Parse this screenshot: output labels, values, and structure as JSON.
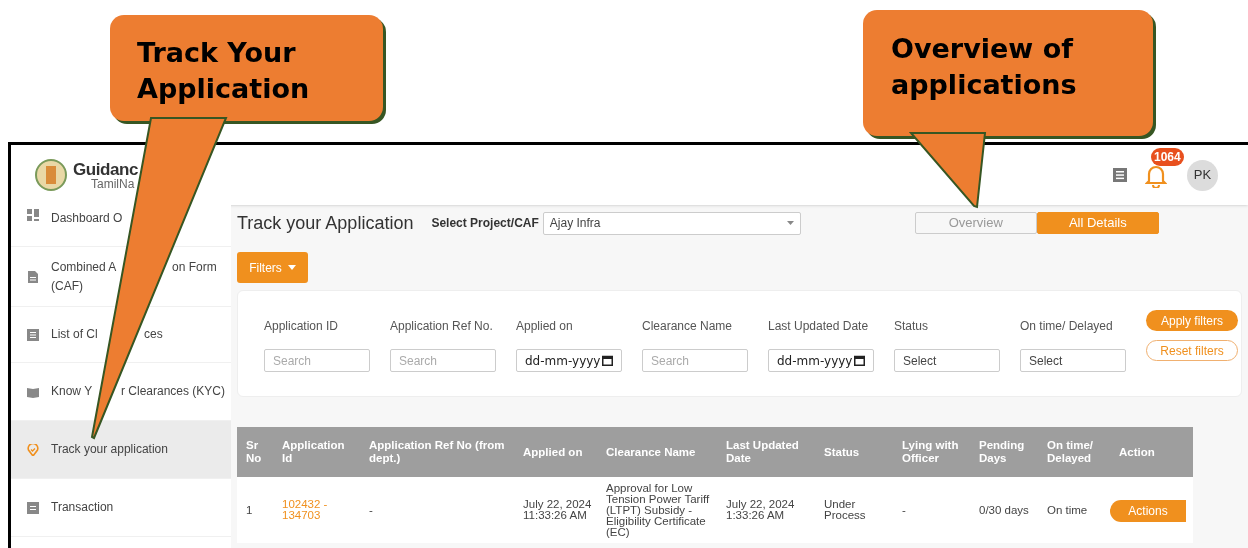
{
  "callouts": [
    {
      "text": "Track Your Application"
    },
    {
      "text": "Overview of applications"
    }
  ],
  "header": {
    "logo_title": "Guidanc",
    "logo_subtitle": "TamilNa",
    "notification_count": "1064",
    "avatar": "PK"
  },
  "sidebar": {
    "items": [
      {
        "label_parts": [
          "Dashboard O"
        ],
        "selected": false
      },
      {
        "label_parts": [
          "Combined A",
          "on Form",
          "(CAF)"
        ],
        "selected": false
      },
      {
        "label_parts": [
          "List of Cl",
          "ces"
        ],
        "selected": false
      },
      {
        "label_parts": [
          "Know Y",
          "r Clearances (KYC)"
        ],
        "selected": false
      },
      {
        "label_parts": [
          "Track your application"
        ],
        "selected": true
      },
      {
        "label_parts": [
          "Transaction"
        ],
        "selected": false
      }
    ]
  },
  "page_title": "Track your Application",
  "project": {
    "label": "Select Project/CAF",
    "value": "Ajay Infra"
  },
  "view_toggle": [
    {
      "label": "Overview",
      "selected": false
    },
    {
      "label": "All Details",
      "selected": true
    }
  ],
  "filters_button": "Filters",
  "filters": [
    {
      "label": "Application ID",
      "kind": "text",
      "placeholder": "Search"
    },
    {
      "label": "Application Ref No.",
      "kind": "text",
      "placeholder": "Search"
    },
    {
      "label": "Applied on",
      "kind": "date",
      "value": "dd-mm-yyyy"
    },
    {
      "label": "Clearance Name",
      "kind": "text",
      "placeholder": "Search"
    },
    {
      "label": "Last Updated Date",
      "kind": "date",
      "value": "dd-mm-yyyy"
    },
    {
      "label": "Status",
      "kind": "select",
      "value": "Select"
    },
    {
      "label": "On time/ Delayed",
      "kind": "select",
      "value": "Select"
    }
  ],
  "apply_button": "Apply filters",
  "reset_button": "Reset filters",
  "table": {
    "columns": [
      "Sr No",
      "Application Id",
      "Application Ref No (from dept.)",
      "Applied on",
      "Clearance Name",
      "Last Updated Date",
      "Status",
      "Lying with Officer",
      "Pending Days",
      "On time/ Delayed",
      "Action"
    ],
    "rows": [
      {
        "cells": [
          "1",
          "102432 - 134703",
          "-",
          "July 22, 2024 11:33:26 AM",
          "Approval for Low Tension Power Tariff (LTPT) Subsidy - Eligibility Certificate (EC)",
          "July 22, 2024 1:33:26 AM",
          "Under Process",
          "-",
          "0/30 days",
          "On time"
        ],
        "action": "Actions"
      }
    ]
  }
}
